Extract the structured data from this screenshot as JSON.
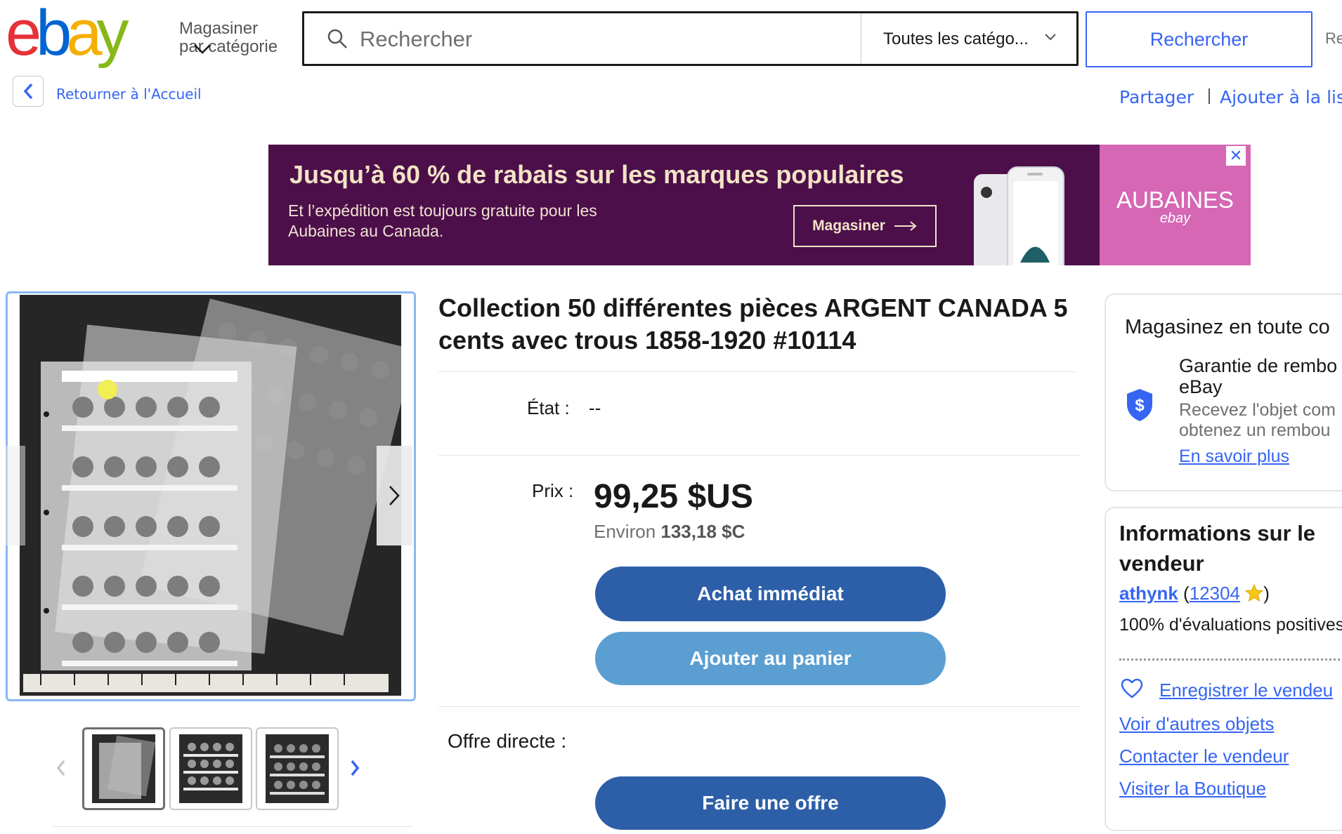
{
  "header": {
    "logo_letters": [
      "e",
      "b",
      "a",
      "y"
    ],
    "shop_by_category": [
      "Magasiner",
      "par catégorie"
    ],
    "search_placeholder": "Rechercher",
    "category_select": "Toutes les catégo...",
    "search_button": "Rechercher",
    "cut_text": "Re"
  },
  "subnav": {
    "back_label": "Retourner à l'Accueil",
    "share": "Partager",
    "add_to_list": "Ajouter à la lis"
  },
  "banner": {
    "title": "Jusqu’à 60 % de rabais sur les marques populaires",
    "subtitle": "Et l’expédition est toujours gratuite pour les Aubaines au Canada.",
    "button": "Magasiner",
    "brand": "AUBAINES",
    "brand_sub": "ebay",
    "close": "✕"
  },
  "item": {
    "title": "Collection 50 différentes pièces ARGENT CANADA 5 cents avec trous 1858-1920 #10114",
    "condition_label": "État :",
    "condition_value": "--",
    "price_label": "Prix :",
    "price": "99,25 $US",
    "approx_label": "Environ",
    "approx_value": "133,18 $C",
    "buy_now": "Achat immédiat",
    "add_to_cart": "Ajouter au panier",
    "offer_label": "Offre directe :",
    "make_offer": "Faire une offre"
  },
  "gallery": {
    "image_count": 3,
    "selected_index": 0
  },
  "guarantee": {
    "title": "Magasinez en toute co",
    "heading_line1": "Garantie de rembo",
    "heading_line2": "eBay",
    "desc_line1": "Recevez l'objet com",
    "desc_line2": "obtenez un rembou",
    "link": "En savoir plus"
  },
  "seller": {
    "title": "Informations sur le vendeur",
    "username": "athynk",
    "feedback_score": "12304",
    "positive": "100% d'évaluations positives",
    "save_seller": "Enregistrer le vendeu",
    "see_other": "Voir d'autres objets",
    "contact": "Contacter le vendeur",
    "visit_store": "Visiter la Boutique"
  },
  "colors": {
    "accent_blue": "#3665f3",
    "button_primary": "#2d5fa8",
    "button_secondary": "#5b9ed2",
    "banner_bg": "#4c0f4a",
    "banner_pink": "#d567b4"
  }
}
